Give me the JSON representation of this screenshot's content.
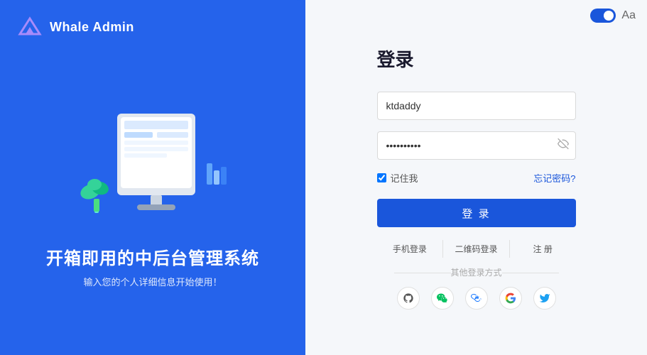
{
  "header": {
    "logo_text": "Whale Admin"
  },
  "left": {
    "tagline": "开箱即用的中后台管理系统",
    "subtitle": "输入您的个人详细信息开始使用！"
  },
  "form": {
    "title": "登录",
    "username_placeholder": "ktdaddy",
    "username_value": "ktdaddy",
    "password_value": "••••••••••",
    "remember_label": "记住我",
    "forgot_label": "忘记密码?",
    "login_btn_label": "登 录",
    "alt_login_1": "手机登录",
    "alt_login_2": "二维码登录",
    "alt_login_3": "注 册",
    "other_label": "其他登录方式"
  },
  "social": [
    {
      "name": "github",
      "icon": "⊛"
    },
    {
      "name": "wechat",
      "icon": "♻"
    },
    {
      "name": "alipay",
      "icon": "◑"
    },
    {
      "name": "google",
      "icon": "⊙"
    },
    {
      "name": "twitter",
      "icon": "♦"
    }
  ],
  "controls": {
    "toggle_on": true,
    "lang": "Aа"
  }
}
